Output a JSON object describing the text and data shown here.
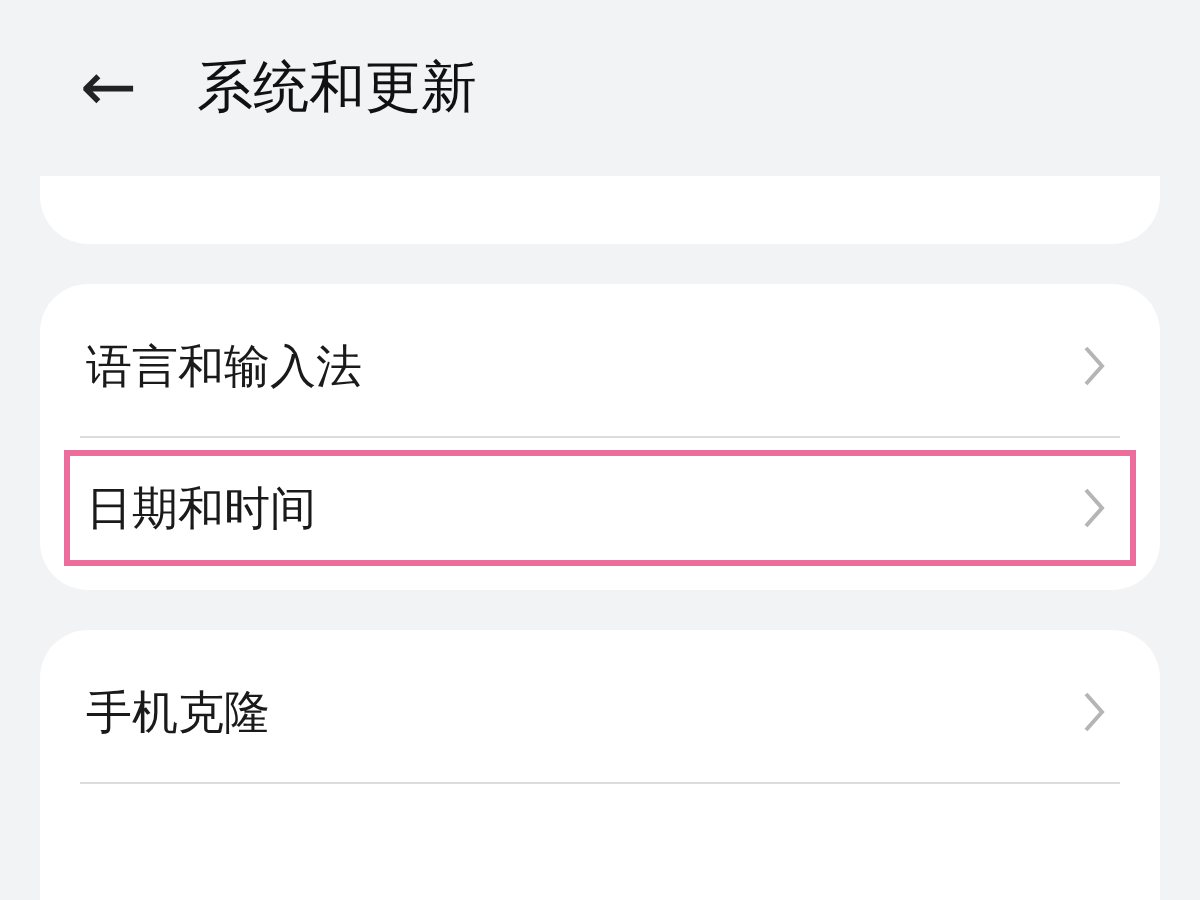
{
  "header": {
    "back": "←",
    "title": "系统和更新"
  },
  "groups": [
    {
      "kind": "cut_top"
    },
    {
      "kind": "full",
      "items": [
        {
          "label": "语言和输入法",
          "highlighted": false
        },
        {
          "label": "日期和时间",
          "highlighted": true
        }
      ]
    },
    {
      "kind": "cut_bottom",
      "items": [
        {
          "label": "手机克隆",
          "highlighted": false
        }
      ]
    }
  ]
}
